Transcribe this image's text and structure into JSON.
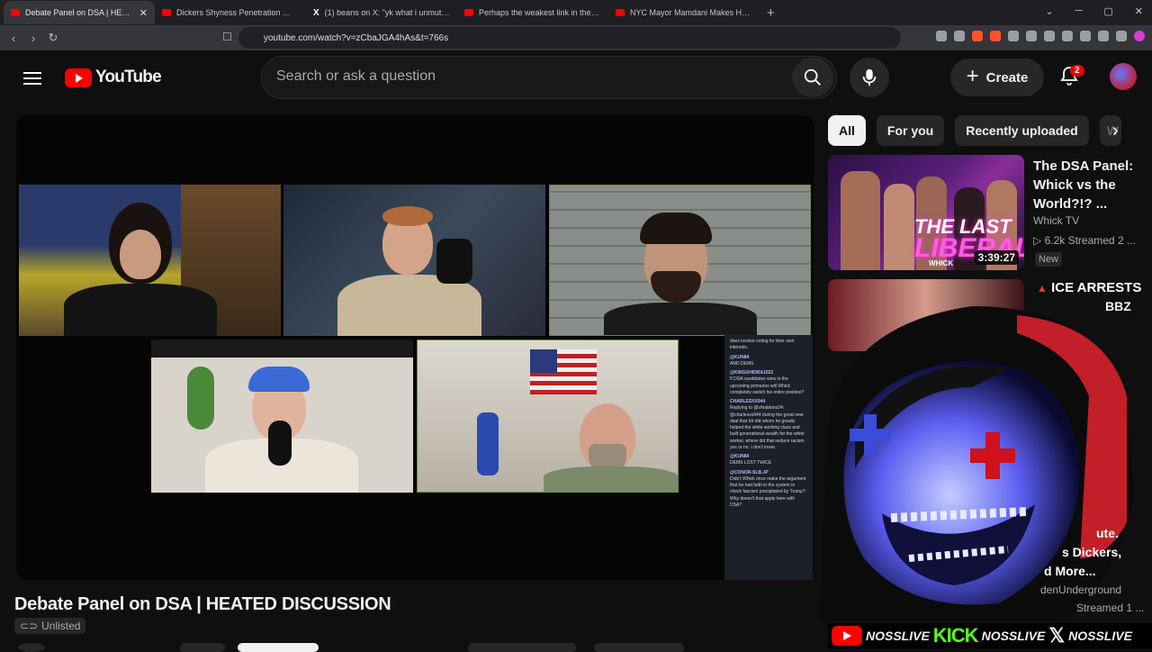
{
  "browser": {
    "tabs": [
      {
        "title": "Debate Panel on DSA | HEATE",
        "active": true,
        "icon": "youtube-icon"
      },
      {
        "title": "Dickers Shyness Penetration 🥚 W",
        "active": false,
        "icon": "youtube-icon"
      },
      {
        "title": "(1) beans on X: \"yk what i unmuted it",
        "active": false,
        "icon": "x-icon"
      },
      {
        "title": "Perhaps the weakest link in the US el",
        "active": false,
        "icon": "youtube-icon"
      },
      {
        "title": "NYC Mayor Mamdani Makes Housing",
        "active": false,
        "icon": "youtube-icon"
      }
    ],
    "new_tab": "+",
    "url": "youtube.com/watch?v=zCbaJGA4hAs&t=766s"
  },
  "header": {
    "logo_text": "YouTube",
    "search_placeholder": "Search or ask a question",
    "create_label": "Create",
    "notification_count": "2"
  },
  "filters": {
    "chips": [
      "All",
      "For you",
      "Recently uploaded",
      "W"
    ],
    "active": "All"
  },
  "recommendations": [
    {
      "title": "The DSA Panel: Whick vs the World?!? ...",
      "channel": "Whick TV",
      "meta": "▷ 6.2k  Streamed 2 ...",
      "badge": "New",
      "duration": "3:39:27",
      "thumb_text_top": "THE LAST",
      "thumb_text_bottom": "LIBERAL",
      "thumb_small": "WHICK"
    },
    {
      "title": "ICE ARRESTS",
      "title_cont": "BBZ"
    }
  ],
  "overlay_fragments": {
    "l1": "ute.",
    "l2": "s Dickers,",
    "l3": "d More...",
    "l4": "denUnderground",
    "l5": "Streamed 1 ..."
  },
  "chat": [
    {
      "user": "",
      "text": "does involve voting for their own interests."
    },
    {
      "user": "@KUN84",
      "text": "AND DEMS"
    },
    {
      "user": "@KINGGHIDRA1022",
      "text": "If DSA candidates wins in the upcoming primaries will Whick completely switch his entire position?"
    },
    {
      "user": "CHARLESXX944",
      "text": ""
    },
    {
      "user": "",
      "text": "Replying to @ofirablons24: @charlesxx944 during the great new deal that fdr did whom he greatly helped the white working class and built generational wealth for the white worker, where did that seduce racism yes or no. I don't know"
    },
    {
      "user": "@KUN84",
      "text": "DEMS LOST TWICE"
    },
    {
      "user": "@CONOR-SLB.JP",
      "text": "Didn't Whick once make the argument that he had faith in the system to check fascism precipitated by Trump? Why doesn't that apply here with DSA?"
    }
  ],
  "video": {
    "title": "Debate Panel on DSA | HEATED DISCUSSION",
    "visibility": "Unlisted"
  },
  "stream_banner": {
    "handle1": "NOSSLIVE",
    "kick_text": "KICK",
    "handle2": "NOSSLIVE",
    "x_text": "𝕏",
    "handle3": "NOSSLIVE"
  },
  "colors": {
    "accent_red": "#ff0000",
    "kick_green": "#53fc18",
    "background": "#0f0f0f"
  }
}
